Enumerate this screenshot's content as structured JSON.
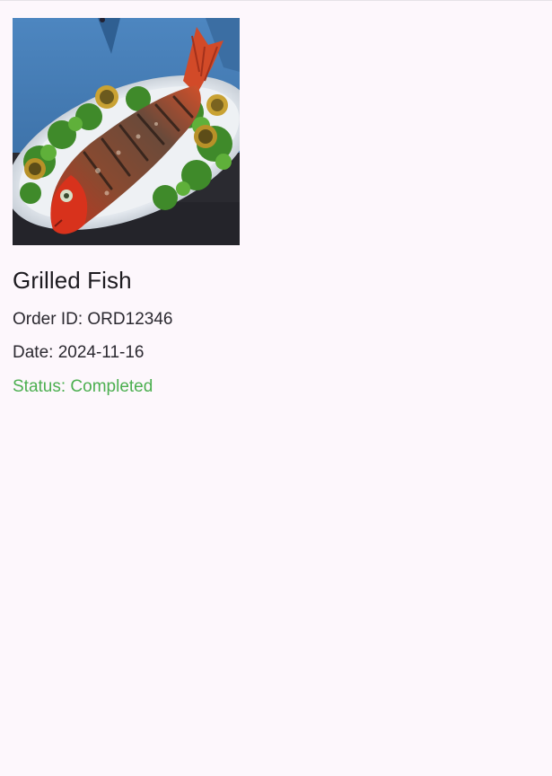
{
  "order": {
    "image_alt": "Grilled fish on a platter",
    "dish_name": "Grilled Fish",
    "order_id_text": "Order ID: ORD12346",
    "date_text": "Date: 2024-11-16",
    "status_text": "Status: Completed",
    "status_color": "#4caf50"
  },
  "theme": {
    "background": "#fdf7fc",
    "text": "#1d1b20"
  }
}
